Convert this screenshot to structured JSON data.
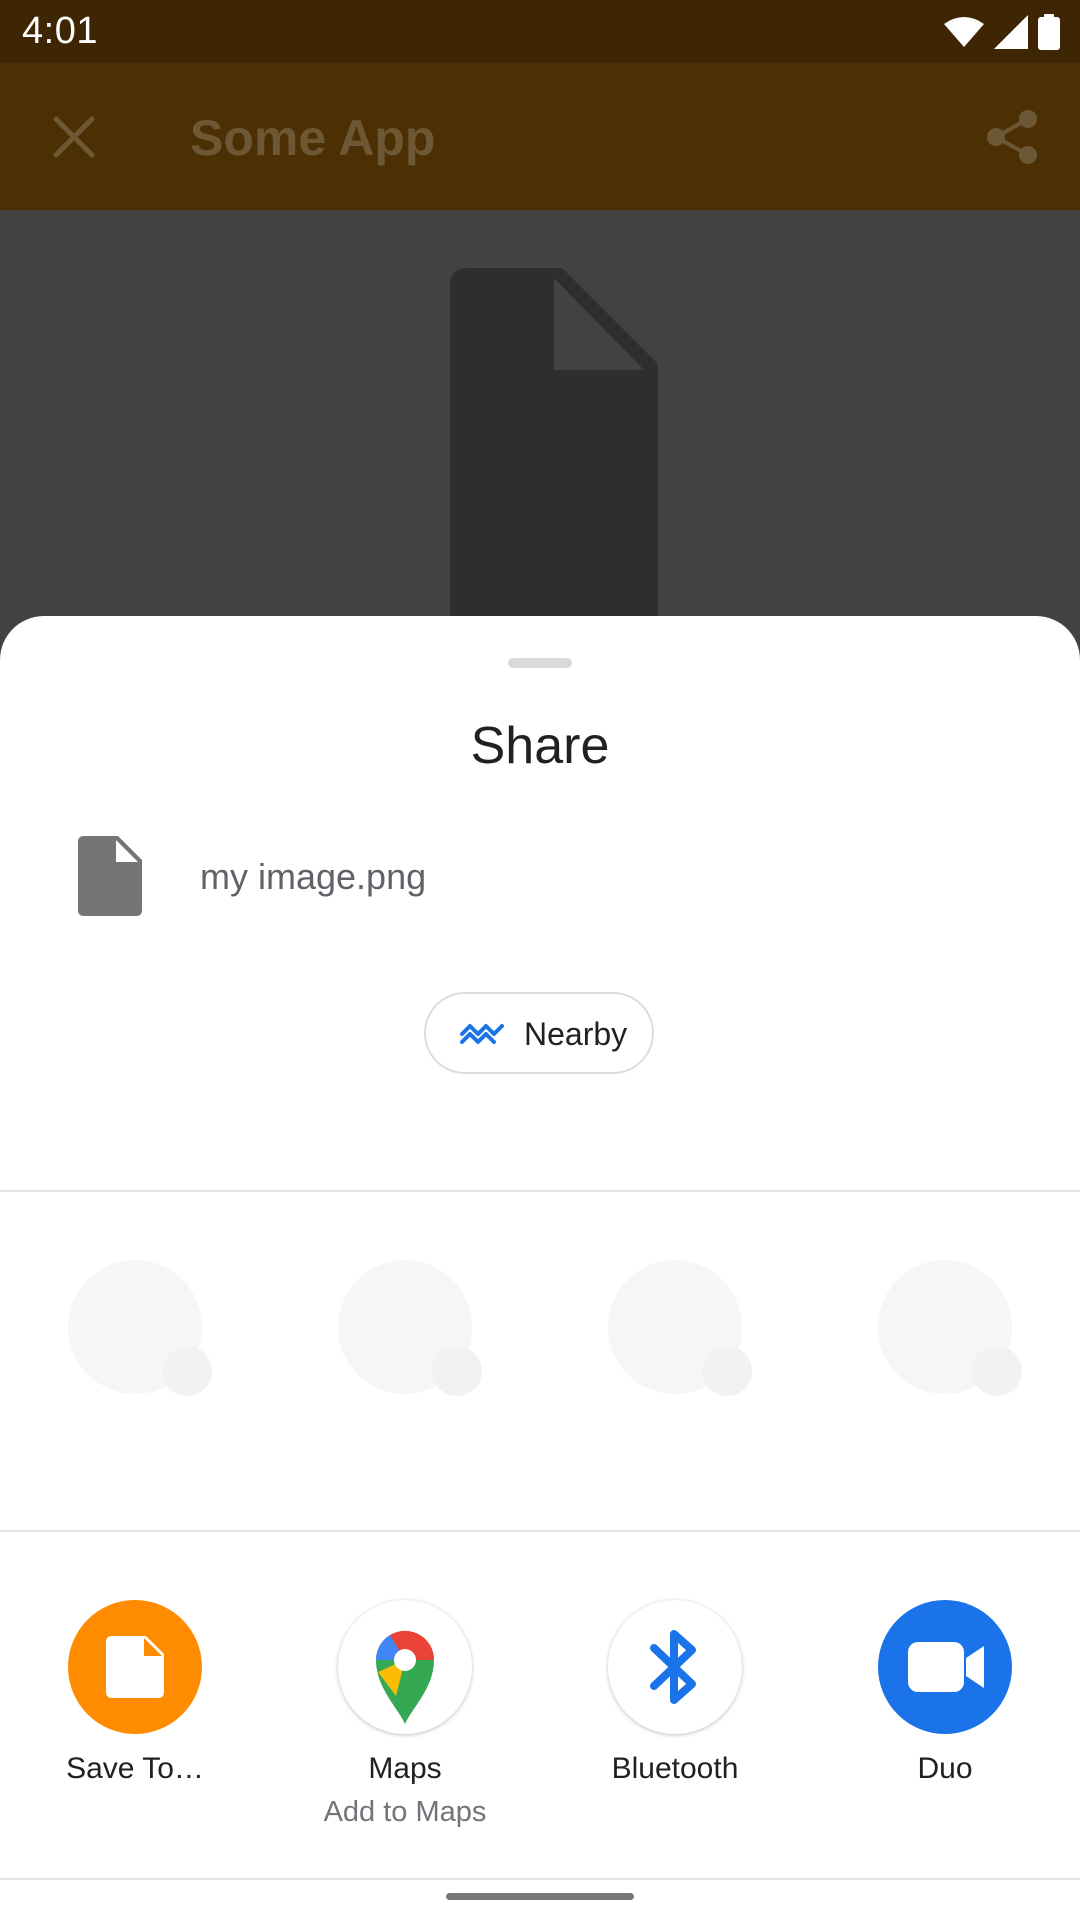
{
  "status_bar": {
    "time": "4:01",
    "icons": [
      "wifi-icon",
      "cell-signal-icon",
      "battery-icon"
    ]
  },
  "app_bar": {
    "title": "Some App",
    "close_icon": "close-icon",
    "share_icon": "share-icon"
  },
  "share_sheet": {
    "title": "Share",
    "file_name": "my image.png",
    "nearby_label": "Nearby",
    "direct_share_placeholders": 4,
    "targets": [
      {
        "label": "Save To…",
        "sub": "",
        "icon": "save-to-icon",
        "color": "#ff8c00"
      },
      {
        "label": "Maps",
        "sub": "Add to Maps",
        "icon": "maps-icon",
        "color": "#ffffff"
      },
      {
        "label": "Bluetooth",
        "sub": "",
        "icon": "bluetooth-icon",
        "color": "#ffffff"
      },
      {
        "label": "Duo",
        "sub": "",
        "icon": "duo-icon",
        "color": "#1a73e8"
      }
    ]
  },
  "colors": {
    "status_bar_bg": "#3e2604",
    "app_bar_bg": "#4d2f04",
    "scrim_content": "#424242",
    "accent_blue": "#1a73e8"
  }
}
